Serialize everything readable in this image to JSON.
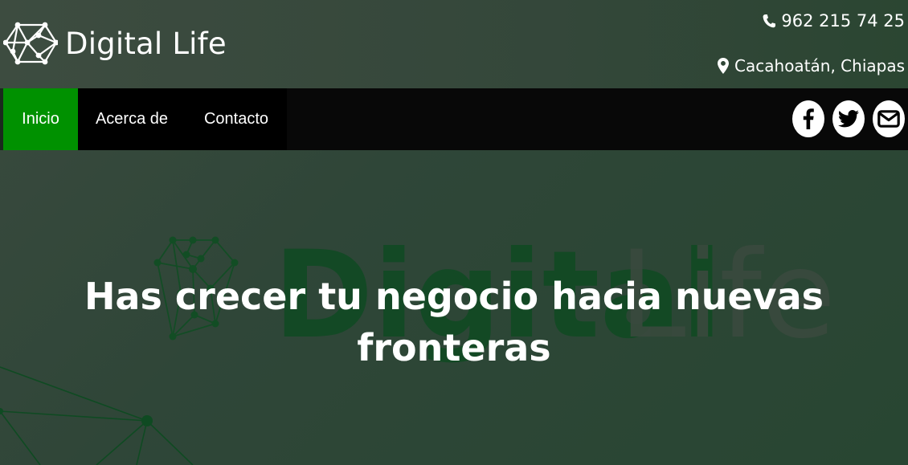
{
  "brand": {
    "name": "Digital Life",
    "logo_icon": "network-diamond-logo"
  },
  "contact": {
    "phone": "962 215 74 25",
    "phone_icon": "phone-icon",
    "location": "Cacahoatán, Chiapas",
    "location_icon": "map-marker-icon"
  },
  "nav": {
    "items": [
      {
        "label": "Inicio",
        "active": true
      },
      {
        "label": "Acerca de",
        "active": false
      },
      {
        "label": "Contacto",
        "active": false
      }
    ]
  },
  "socials": [
    {
      "name": "facebook",
      "icon": "facebook-icon"
    },
    {
      "name": "twitter",
      "icon": "twitter-icon"
    },
    {
      "name": "email",
      "icon": "envelope-icon"
    }
  ],
  "hero": {
    "title": "Has crecer tu negocio hacia nuevas fronteras",
    "watermark_logo_text_1": "Digital",
    "watermark_logo_text_2": "Life"
  },
  "colors": {
    "accent_green": "#009100",
    "navbar_bg": "#000000",
    "watermark_dark_green": "#0f4a22",
    "watermark_light": "#3a4a3e"
  }
}
